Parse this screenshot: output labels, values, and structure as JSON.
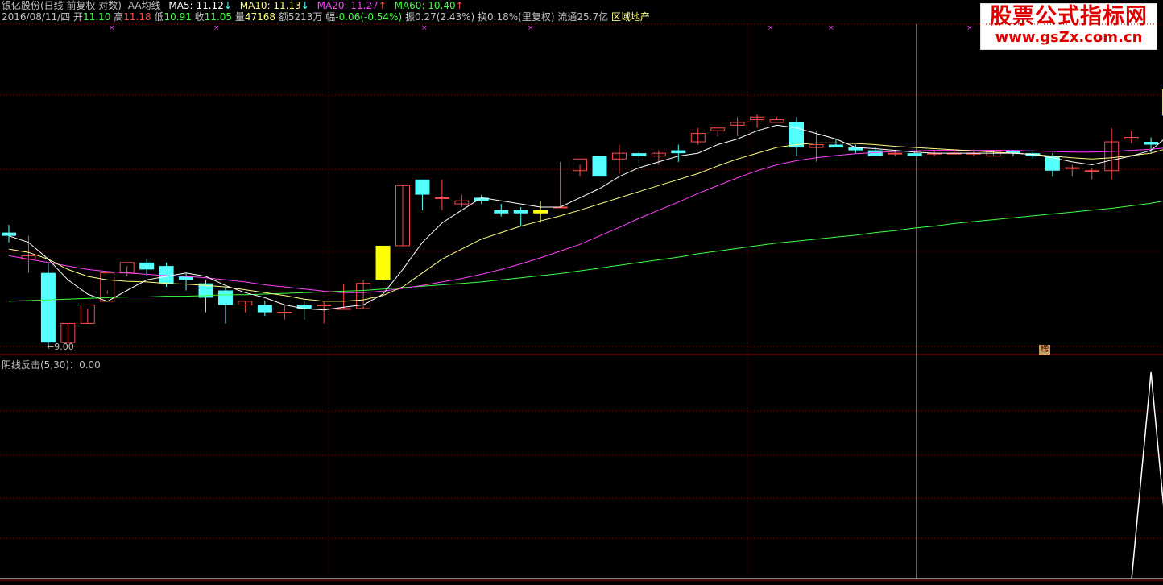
{
  "header": {
    "stock": "银亿股份(日线 前复权 对数)",
    "indicator": "AA均线",
    "ma5": "MA5: 11.12",
    "ma5_arrow": "↓",
    "ma10": "MA10: 11.13",
    "ma10_arrow": "↓",
    "ma20": "MA20: 11.27",
    "ma20_arrow": "↑",
    "ma60": "MA60: 10.40",
    "ma60_arrow": "↑",
    "date": "2016/08/11/四",
    "open_label": "开",
    "open": "11.10",
    "high_label": "高",
    "high": "11.18",
    "low_label": "低",
    "low": "10.91",
    "close_label": "收",
    "close": "11.05",
    "vol_label": "量",
    "vol": "47168",
    "amt": "额5213万",
    "chg_label": "幅",
    "chg": "-0.06(-0.54%)",
    "amp": "振0.27(2.43%)",
    "turnover": "换0.18%(里复权)",
    "float": "流通25.7亿",
    "sector": "区域地产"
  },
  "watermark": {
    "title": "股票公式指标网",
    "url": "www.gsZx.com.cn"
  },
  "indicator_panel": {
    "label": "阴线反击(5,30)：0.00"
  },
  "low_marker": "←9.00",
  "badge": "榜",
  "colors": {
    "background": "#000000",
    "up": "#ff4a4a",
    "down": "#54ffff",
    "limit": "#ffff00",
    "ma5": "#ffffff",
    "ma10": "#ffff80",
    "ma20": "#ff40ff",
    "ma60": "#40ff40",
    "grid": "#8b0000"
  },
  "chart_data": {
    "type": "candlestick",
    "ohlc": [
      [
        9.6,
        9.72,
        9.55,
        9.45
      ],
      [
        9.2,
        9.55,
        9.25,
        9.0
      ],
      [
        9.0,
        9.15,
        8.05,
        8.0
      ],
      [
        8.05,
        8.05,
        8.3,
        8.3
      ],
      [
        8.3,
        8.5,
        8.55,
        8.3
      ],
      [
        8.6,
        8.7,
        9.0,
        8.75
      ],
      [
        9.0,
        9.1,
        9.15,
        8.95
      ],
      [
        9.15,
        9.2,
        9.05,
        8.95
      ],
      [
        9.1,
        9.15,
        8.85,
        8.8
      ],
      [
        8.95,
        9.0,
        8.9,
        8.75
      ],
      [
        8.85,
        8.9,
        8.65,
        8.45
      ],
      [
        8.75,
        8.8,
        8.55,
        8.3
      ],
      [
        8.55,
        8.6,
        8.6,
        8.45
      ],
      [
        8.55,
        8.6,
        8.45,
        8.4
      ],
      [
        8.45,
        8.55,
        8.45,
        8.35
      ],
      [
        8.55,
        8.6,
        8.5,
        8.35
      ],
      [
        8.55,
        8.6,
        8.55,
        8.3
      ],
      [
        8.5,
        8.85,
        8.5,
        8.5
      ],
      [
        8.5,
        8.9,
        8.85,
        8.5
      ],
      [
        8.9,
        9.35,
        9.4,
        8.85
      ],
      [
        9.4,
        10.35,
        10.35,
        9.4
      ],
      [
        10.45,
        10.45,
        10.2,
        9.95
      ],
      [
        10.15,
        10.45,
        10.15,
        9.95
      ],
      [
        10.05,
        10.2,
        10.1,
        10.0
      ],
      [
        10.15,
        10.2,
        10.1,
        10.05
      ],
      [
        9.95,
        10.05,
        9.9,
        9.85
      ],
      [
        9.95,
        10.0,
        9.9,
        9.7
      ],
      [
        9.95,
        10.1,
        9.9,
        9.75
      ],
      [
        10.0,
        10.75,
        10.0,
        10.0
      ],
      [
        10.6,
        10.7,
        10.8,
        10.5
      ],
      [
        10.85,
        10.85,
        10.5,
        10.5
      ],
      [
        10.8,
        11.05,
        10.9,
        10.55
      ],
      [
        10.9,
        10.95,
        10.85,
        10.6
      ],
      [
        10.85,
        10.95,
        10.9,
        10.7
      ],
      [
        10.95,
        11.05,
        10.9,
        10.75
      ],
      [
        11.1,
        11.35,
        11.25,
        11.05
      ],
      [
        11.3,
        11.3,
        11.35,
        11.2
      ],
      [
        11.4,
        11.55,
        11.45,
        11.2
      ],
      [
        11.5,
        11.6,
        11.55,
        11.35
      ],
      [
        11.45,
        11.55,
        11.5,
        11.5
      ],
      [
        11.45,
        11.55,
        11.0,
        10.85
      ],
      [
        11.0,
        11.3,
        11.05,
        10.75
      ],
      [
        11.05,
        11.15,
        11.0,
        11.0
      ],
      [
        11.0,
        11.05,
        10.95,
        10.9
      ],
      [
        10.95,
        11.0,
        10.85,
        10.85
      ],
      [
        10.9,
        10.95,
        10.9,
        10.85
      ],
      [
        10.9,
        10.95,
        10.85,
        10.85
      ],
      [
        10.9,
        10.95,
        10.9,
        10.85
      ],
      [
        10.9,
        10.95,
        10.9,
        10.9
      ],
      [
        10.9,
        10.95,
        10.9,
        10.85
      ],
      [
        10.85,
        10.95,
        10.95,
        10.85
      ],
      [
        10.95,
        10.95,
        10.9,
        10.85
      ],
      [
        10.9,
        10.95,
        10.85,
        10.8
      ],
      [
        10.85,
        10.9,
        10.6,
        10.5
      ],
      [
        10.65,
        10.7,
        10.65,
        10.5
      ],
      [
        10.6,
        10.65,
        10.6,
        10.45
      ],
      [
        10.6,
        11.35,
        11.1,
        10.45
      ],
      [
        11.15,
        11.3,
        11.18,
        11.08
      ],
      [
        11.1,
        11.18,
        11.05,
        10.91
      ],
      [
        11.6,
        12.2,
        12.05,
        11.6
      ],
      [
        12.05,
        12.8,
        12.05,
        12.0
      ],
      [
        12.7,
        13.3,
        13.2,
        12.7
      ]
    ],
    "limit_up_days": [
      19,
      27
    ],
    "limit_up_special": [
      59
    ],
    "ma5": [
      9.55,
      9.45,
      9.2,
      8.9,
      8.7,
      8.6,
      8.75,
      8.9,
      8.95,
      9.0,
      8.95,
      8.82,
      8.72,
      8.65,
      8.55,
      8.5,
      8.48,
      8.52,
      8.55,
      8.7,
      9.05,
      9.45,
      9.75,
      9.95,
      10.15,
      10.1,
      10.05,
      10.0,
      10.0,
      10.15,
      10.3,
      10.5,
      10.65,
      10.75,
      10.85,
      10.9,
      11.05,
      11.15,
      11.3,
      11.4,
      11.35,
      11.25,
      11.15,
      11.0,
      10.98,
      10.95,
      10.92,
      10.9,
      10.9,
      10.9,
      10.9,
      10.9,
      10.88,
      10.82,
      10.75,
      10.7,
      10.78,
      10.85,
      10.95,
      11.25,
      11.6,
      12.0
    ],
    "ma10": [
      9.35,
      9.3,
      9.2,
      9.05,
      8.95,
      8.9,
      8.88,
      8.87,
      8.85,
      8.84,
      8.82,
      8.8,
      8.76,
      8.72,
      8.68,
      8.63,
      8.6,
      8.6,
      8.62,
      8.68,
      8.8,
      9.0,
      9.2,
      9.35,
      9.5,
      9.6,
      9.7,
      9.78,
      9.86,
      9.95,
      10.05,
      10.15,
      10.25,
      10.35,
      10.45,
      10.55,
      10.68,
      10.8,
      10.9,
      11.0,
      11.05,
      11.08,
      11.08,
      11.07,
      11.05,
      11.02,
      11.0,
      10.98,
      10.96,
      10.94,
      10.92,
      10.9,
      10.88,
      10.85,
      10.82,
      10.8,
      10.82,
      10.86,
      10.9,
      11.0,
      11.1,
      11.25
    ],
    "ma20": [
      9.25,
      9.2,
      9.15,
      9.1,
      9.05,
      9.02,
      9.0,
      8.98,
      8.96,
      8.95,
      8.93,
      8.9,
      8.87,
      8.83,
      8.8,
      8.77,
      8.74,
      8.72,
      8.72,
      8.74,
      8.78,
      8.82,
      8.87,
      8.92,
      8.98,
      9.05,
      9.13,
      9.22,
      9.32,
      9.42,
      9.55,
      9.68,
      9.82,
      9.95,
      10.08,
      10.22,
      10.35,
      10.48,
      10.6,
      10.7,
      10.77,
      10.82,
      10.86,
      10.89,
      10.91,
      10.93,
      10.94,
      10.95,
      10.95,
      10.95,
      10.95,
      10.95,
      10.94,
      10.93,
      10.92,
      10.92,
      10.93,
      10.95,
      10.97,
      11.0,
      11.1,
      11.27
    ],
    "ma60": [
      8.6,
      8.61,
      8.62,
      8.63,
      8.64,
      8.65,
      8.66,
      8.66,
      8.67,
      8.67,
      8.68,
      8.69,
      8.69,
      8.7,
      8.71,
      8.72,
      8.73,
      8.74,
      8.75,
      8.77,
      8.79,
      8.81,
      8.83,
      8.85,
      8.87,
      8.9,
      8.93,
      8.96,
      8.99,
      9.03,
      9.07,
      9.11,
      9.15,
      9.19,
      9.23,
      9.28,
      9.32,
      9.36,
      9.4,
      9.44,
      9.47,
      9.5,
      9.53,
      9.56,
      9.6,
      9.63,
      9.67,
      9.7,
      9.74,
      9.77,
      9.8,
      9.83,
      9.86,
      9.89,
      9.92,
      9.95,
      9.98,
      10.02,
      10.06,
      10.12,
      10.22,
      10.4
    ],
    "ylim": [
      8.0,
      13.4
    ],
    "indicator": {
      "name": "阴线反击",
      "x_active": 58,
      "value": 1
    }
  }
}
